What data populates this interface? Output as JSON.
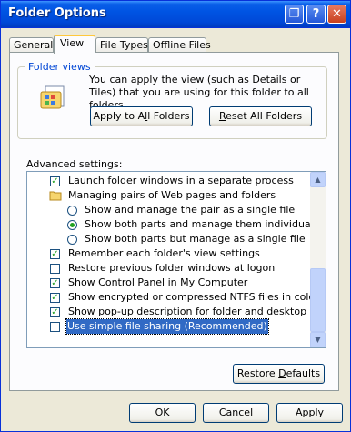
{
  "window": {
    "title": "Folder Options",
    "controls": {
      "help": "?",
      "close": "✕",
      "shrink": "❐"
    }
  },
  "tabs": [
    {
      "label": "General"
    },
    {
      "label": "View"
    },
    {
      "label": "File Types"
    },
    {
      "label": "Offline Files"
    }
  ],
  "folder_views": {
    "legend": "Folder views",
    "description": "You can apply the view (such as Details or Tiles) that you are using for this folder to all folders.",
    "apply_button": {
      "pre": "Apply to A",
      "u": "l",
      "post": "l Folders"
    },
    "reset_button": {
      "pre": "",
      "u": "R",
      "post": "eset All Folders"
    }
  },
  "advanced": {
    "label": "Advanced settings:",
    "items": [
      {
        "type": "checkbox",
        "checked": true,
        "label": "Launch folder windows in a separate process"
      },
      {
        "type": "folder",
        "label": "Managing pairs of Web pages and folders"
      },
      {
        "type": "radio",
        "checked": false,
        "label": "Show and manage the pair as a single file"
      },
      {
        "type": "radio",
        "checked": true,
        "label": "Show both parts and manage them individually"
      },
      {
        "type": "radio",
        "checked": false,
        "label": "Show both parts but manage as a single file"
      },
      {
        "type": "checkbox",
        "checked": true,
        "label": "Remember each folder's view settings"
      },
      {
        "type": "checkbox",
        "checked": false,
        "label": "Restore previous folder windows at logon"
      },
      {
        "type": "checkbox",
        "checked": true,
        "label": "Show Control Panel in My Computer"
      },
      {
        "type": "checkbox",
        "checked": true,
        "label": "Show encrypted or compressed NTFS files in color"
      },
      {
        "type": "checkbox",
        "checked": true,
        "label": "Show pop-up description for folder and desktop items"
      },
      {
        "type": "checkbox",
        "checked": false,
        "label": "Use simple file sharing (Recommended)"
      }
    ]
  },
  "restore_defaults": {
    "pre": "Restore ",
    "u": "D",
    "post": "efaults"
  },
  "buttons": {
    "ok": "OK",
    "cancel": "Cancel",
    "apply": {
      "pre": "",
      "u": "A",
      "post": "pply"
    }
  }
}
